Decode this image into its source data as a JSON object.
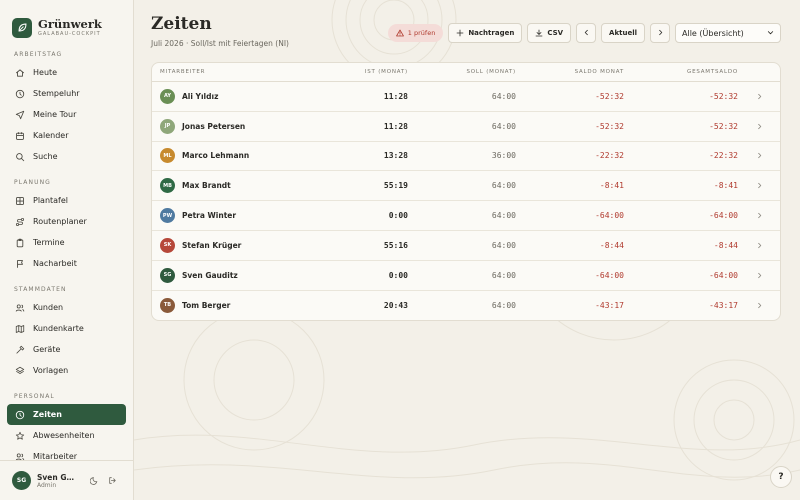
{
  "brand": {
    "name": "Grünwerk",
    "subtitle": "GALABAU-COCKPIT"
  },
  "sidebar": {
    "sections": [
      {
        "label": "ARBEITSTAG",
        "items": [
          {
            "label": "Heute",
            "icon": "home-icon"
          },
          {
            "label": "Stempeluhr",
            "icon": "clock-icon"
          },
          {
            "label": "Meine Tour",
            "icon": "navigation-icon"
          },
          {
            "label": "Kalender",
            "icon": "calendar-icon"
          },
          {
            "label": "Suche",
            "icon": "search-icon"
          }
        ]
      },
      {
        "label": "PLANUNG",
        "items": [
          {
            "label": "Plantafel",
            "icon": "grid-icon"
          },
          {
            "label": "Routenplaner",
            "icon": "route-icon"
          },
          {
            "label": "Termine",
            "icon": "clipboard-icon"
          },
          {
            "label": "Nacharbeit",
            "icon": "flag-icon"
          }
        ]
      },
      {
        "label": "STAMMDATEN",
        "items": [
          {
            "label": "Kunden",
            "icon": "users-icon"
          },
          {
            "label": "Kundenkarte",
            "icon": "map-icon"
          },
          {
            "label": "Geräte",
            "icon": "hammer-icon"
          },
          {
            "label": "Vorlagen",
            "icon": "layers-icon"
          }
        ]
      },
      {
        "label": "PERSONAL",
        "items": [
          {
            "label": "Zeiten",
            "icon": "clock-icon",
            "active": true
          },
          {
            "label": "Abwesenheiten",
            "icon": "star-icon"
          },
          {
            "label": "Mitarbeiter",
            "icon": "users-icon"
          }
        ]
      }
    ],
    "user": {
      "initials": "SG",
      "name": "Sven Gauditz",
      "role": "Admin"
    }
  },
  "header": {
    "title": "Zeiten",
    "subtitle": "Juli 2026 · Soll/Ist mit Feiertagen (NI)"
  },
  "toolbar": {
    "warning": "1 prüfen",
    "add_label": "Nachtragen",
    "csv_label": "CSV",
    "current_label": "Aktuell",
    "filter_value": "Alle (Übersicht)"
  },
  "table": {
    "headers": {
      "name": "MITARBEITER",
      "ist": "IST (MONAT)",
      "soll": "SOLL (MONAT)",
      "saldo": "SALDO MONAT",
      "total": "GESAMTSALDO"
    },
    "rows": [
      {
        "initials": "AY",
        "name": "Ali Yıldız",
        "ist": "11:28",
        "soll": "64:00",
        "saldo": "-52:32",
        "total": "-52:32",
        "color": "#6a8f55"
      },
      {
        "initials": "JP",
        "name": "Jonas Petersen",
        "ist": "11:28",
        "soll": "64:00",
        "saldo": "-52:32",
        "total": "-52:32",
        "color": "#8fa77a"
      },
      {
        "initials": "ML",
        "name": "Marco Lehmann",
        "ist": "13:28",
        "soll": "36:00",
        "saldo": "-22:32",
        "total": "-22:32",
        "color": "#c78a2e"
      },
      {
        "initials": "MB",
        "name": "Max Brandt",
        "ist": "55:19",
        "soll": "64:00",
        "saldo": "-8:41",
        "total": "-8:41",
        "color": "#2f6a45"
      },
      {
        "initials": "PW",
        "name": "Petra Winter",
        "ist": "0:00",
        "soll": "64:00",
        "saldo": "-64:00",
        "total": "-64:00",
        "color": "#4f7aa0"
      },
      {
        "initials": "SK",
        "name": "Stefan Krüger",
        "ist": "55:16",
        "soll": "64:00",
        "saldo": "-8:44",
        "total": "-8:44",
        "color": "#b6483a"
      },
      {
        "initials": "SG",
        "name": "Sven Gauditz",
        "ist": "0:00",
        "soll": "64:00",
        "saldo": "-64:00",
        "total": "-64:00",
        "color": "#2f5a3e"
      },
      {
        "initials": "TB",
        "name": "Tom Berger",
        "ist": "20:43",
        "soll": "64:00",
        "saldo": "-43:17",
        "total": "-43:17",
        "color": "#8a5a3a"
      }
    ]
  },
  "help_label": "?",
  "colors": {
    "accent": "#2f5a3e",
    "negative": "#b03a2e",
    "warning_bg": "#f4dcd8"
  }
}
